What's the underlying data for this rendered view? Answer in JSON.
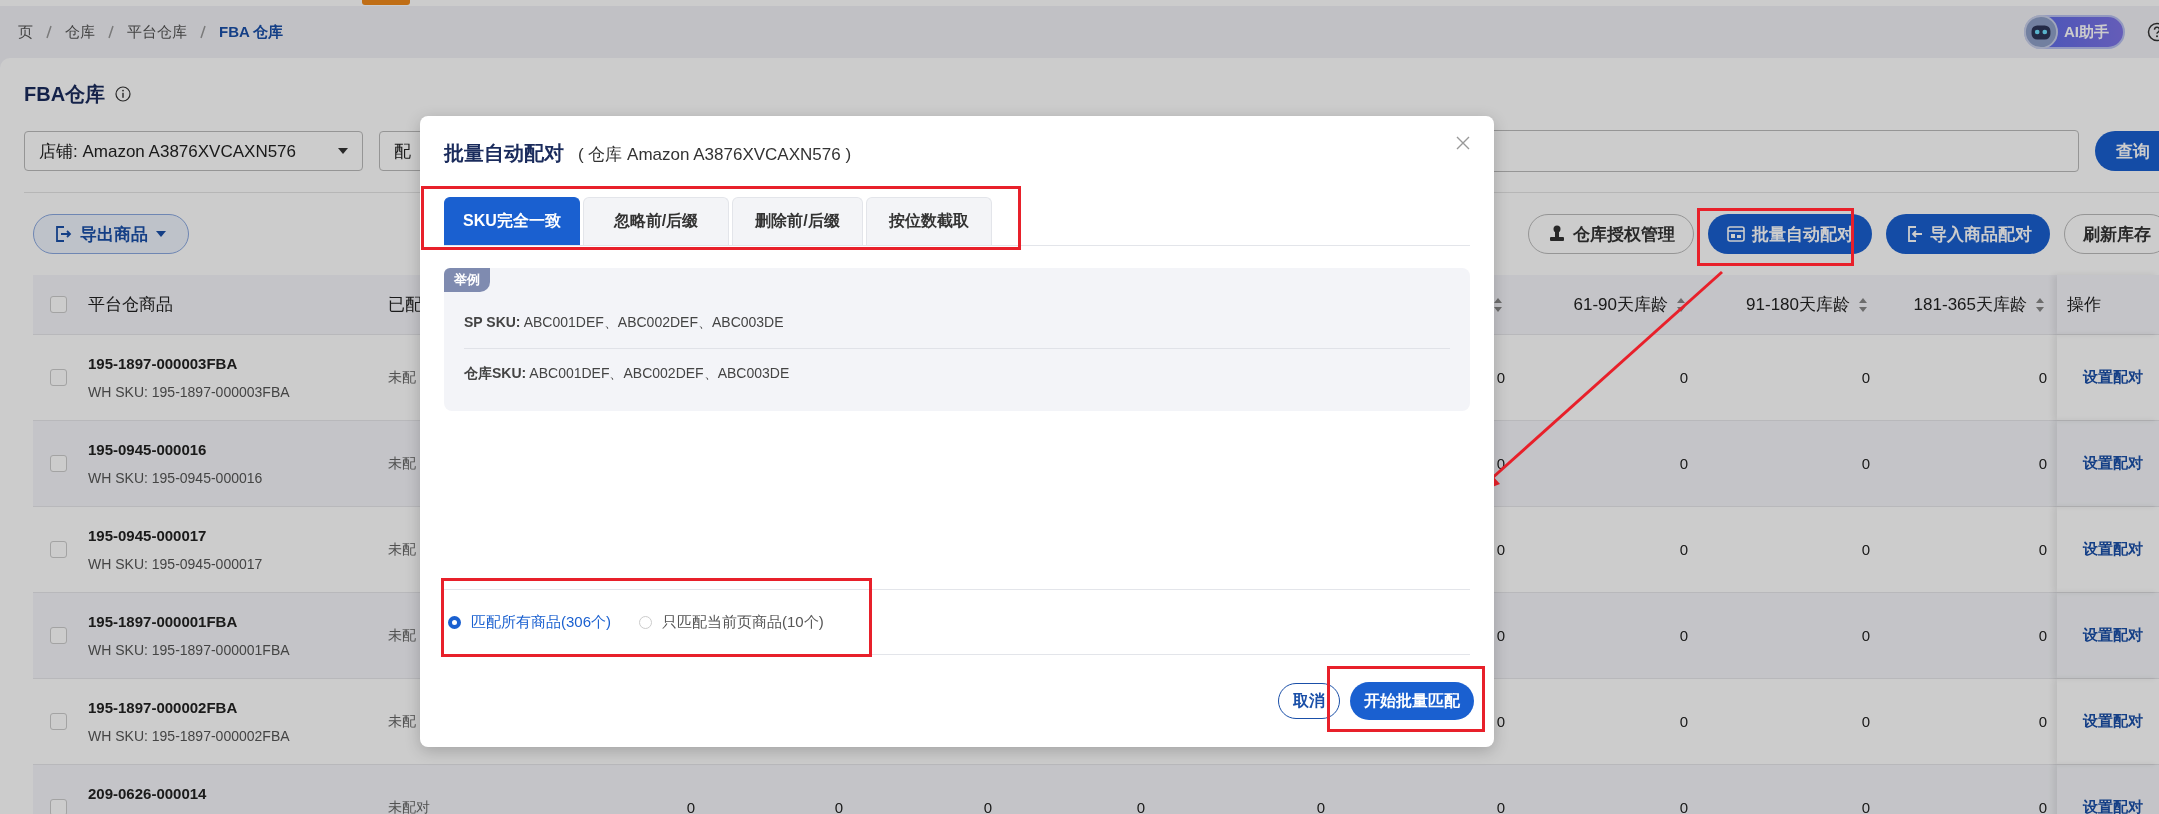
{
  "top_bar": {
    "breadcrumb": [
      {
        "label": "页",
        "current": false
      },
      {
        "label": "仓库",
        "current": false
      },
      {
        "label": "平台仓库",
        "current": false
      },
      {
        "label": "FBA 仓库",
        "current": true
      }
    ],
    "assistant_button": "AI助手"
  },
  "page": {
    "title": "FBA仓库"
  },
  "filters": {
    "store_select": "店铺: Amazon A3876XVCAXN576",
    "match_select": "配",
    "query_button": "查询"
  },
  "toolbar": {
    "export_button": "导出商品",
    "actions": [
      {
        "label": "仓库授权管理",
        "kind": "outline"
      },
      {
        "label": "批量自动配对",
        "kind": "primary"
      },
      {
        "label": "导入商品配对",
        "kind": "primary"
      },
      {
        "label": "刷新库存",
        "kind": "outline"
      }
    ]
  },
  "table": {
    "header": {
      "checked": false,
      "product": "平台仓商品",
      "status": "已配",
      "numeric": [
        {
          "sortable": true
        },
        {
          "label": "61-90天库龄",
          "sortable": true
        },
        {
          "label": "91-180天库龄",
          "sortable": true
        },
        {
          "label": "181-365天库龄",
          "sortable": true
        }
      ],
      "action": "操作"
    },
    "rows": [
      {
        "checked": false,
        "product": "195-1897-000003FBA",
        "wh_sku": "WH SKU: 195-1897-000003FBA",
        "status": "未配",
        "values": [
          "0",
          "0",
          "0",
          "0"
        ],
        "action": "设置配对"
      },
      {
        "checked": false,
        "product": "195-0945-000016",
        "wh_sku": "WH SKU: 195-0945-000016",
        "status": "未配",
        "values": [
          "0",
          "0",
          "0",
          "0"
        ],
        "action": "设置配对"
      },
      {
        "checked": false,
        "product": "195-0945-000017",
        "wh_sku": "WH SKU: 195-0945-000017",
        "status": "未配",
        "values": [
          "0",
          "0",
          "0",
          "0"
        ],
        "action": "设置配对"
      },
      {
        "checked": false,
        "product": "195-1897-000001FBA",
        "wh_sku": "WH SKU: 195-1897-000001FBA",
        "status": "未配",
        "values": [
          "0",
          "0",
          "0",
          "0"
        ],
        "action": "设置配对"
      },
      {
        "checked": false,
        "product": "195-1897-000002FBA",
        "wh_sku": "WH SKU: 195-1897-000002FBA",
        "status": "未配",
        "values": [
          "0",
          "0",
          "0",
          "0"
        ],
        "action": "设置配对"
      },
      {
        "checked": false,
        "product": "209-0626-000014",
        "status": "未配对",
        "values": [
          "0",
          "0",
          "0",
          "0",
          "0",
          "0",
          "0",
          "0",
          "0"
        ],
        "action": "设置配对"
      }
    ]
  },
  "dialog": {
    "title": "批量自动配对",
    "subtitle": "( 仓库 Amazon A3876XVCAXN576 )",
    "tabs": [
      {
        "label": "SKU完全一致",
        "selected": true
      },
      {
        "label": "忽略前/后缀",
        "selected": false
      },
      {
        "label": "删除前/后缀",
        "selected": false
      },
      {
        "label": "按位数截取",
        "selected": false
      }
    ],
    "example": {
      "tag": "举例",
      "lines": [
        "**SP SKU:** ABC001DEF、ABC002DEF、ABC003DE",
        "**仓库SKU:** ABC001DEF、ABC002DEF、ABC003DE"
      ]
    },
    "scope_options": [
      {
        "label": "匹配所有商品(306个)",
        "selected": true
      },
      {
        "label": "只匹配当前页商品(10个)",
        "selected": false
      }
    ],
    "cancel_button": "取消",
    "confirm_button": "开始批量匹配"
  }
}
